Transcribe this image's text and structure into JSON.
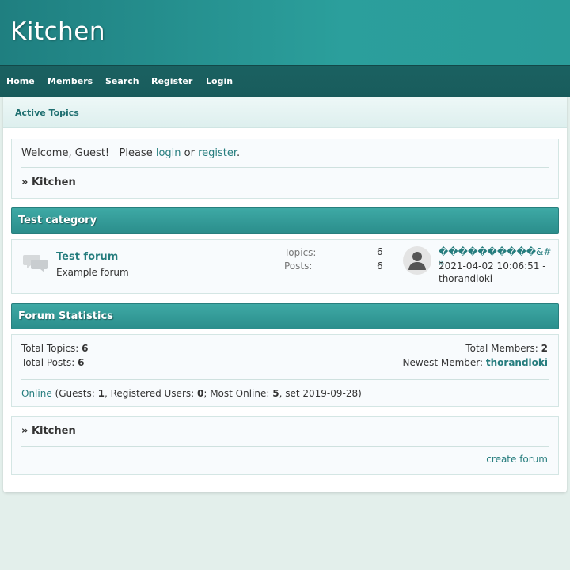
{
  "site": {
    "title": "Kitchen"
  },
  "nav": {
    "items": [
      {
        "label": "Home"
      },
      {
        "label": "Members"
      },
      {
        "label": "Search"
      },
      {
        "label": "Register"
      },
      {
        "label": "Login"
      }
    ]
  },
  "subnav": {
    "active_topics": "Active Topics"
  },
  "welcome": {
    "prefix": "Welcome, Guest!   Please ",
    "login": "login",
    "or": " or ",
    "register": "register",
    "suffix": ".",
    "breadcrumb_arrow": "»",
    "breadcrumb": "Kitchen"
  },
  "category": {
    "title": "Test category",
    "forum": {
      "name": "Test forum",
      "description": "Example forum",
      "topics_label": "Topics:",
      "topics_value": "6",
      "posts_label": "Posts:",
      "posts_value": "6",
      "last_post_title": "����������&# »",
      "last_post_date": "2021-04-02 10:06:51 -",
      "last_post_user": "thorandloki"
    }
  },
  "statistics": {
    "title": "Forum Statistics",
    "total_topics_label": "Total Topics: ",
    "total_topics": "6",
    "total_posts_label": "Total Posts: ",
    "total_posts": "6",
    "total_members_label": "Total Members: ",
    "total_members": "2",
    "newest_member_label": "Newest Member: ",
    "newest_member": "thorandloki",
    "online_link": "Online",
    "online_guests_label": " (Guests: ",
    "online_guests": "1",
    "online_registered_label": ", Registered Users: ",
    "online_registered": "0",
    "online_most_label": "; Most Online: ",
    "online_most": "5",
    "online_date": ", set 2019-09-28)"
  },
  "footer": {
    "breadcrumb_arrow": "»",
    "breadcrumb": "Kitchen",
    "create_forum": "create forum"
  },
  "colors": {
    "header": "#2a9c99",
    "navbar": "#1a6161",
    "category_bar": "#3ea9a5",
    "link": "#267d7e",
    "background": "#e3efeb"
  }
}
